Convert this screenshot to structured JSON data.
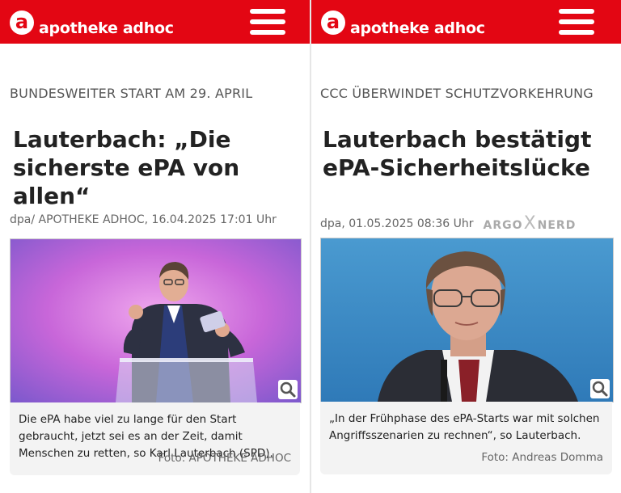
{
  "brand": {
    "logo_letter": "a",
    "name": "apotheke adhoc",
    "color": "#e30613"
  },
  "articles": [
    {
      "kicker": "BUNDESWEITER START AM 29. APRIL",
      "headline": "Lauterbach: „Die sicherste ePA von allen“",
      "meta": "dpa/ APOTHEKE ADHOC, 16.04.2025 17:01 Uhr",
      "caption": "Die ePA habe viel zu lange für den Start gebraucht, jetzt sei es an der Zeit, damit Menschen zu retten, so Karl Lauterbach (SPD).",
      "credit": "Foto: APOTHEKE ADHOC"
    },
    {
      "kicker": "CCC ÜBERWINDET SCHUTZVORKEHRUNG",
      "headline": "Lauterbach bestätigt ePA-Sicherheitslücke",
      "meta": "dpa, 01.05.2025 08:36 Uhr",
      "partner_left": "ARGO",
      "partner_x": "X",
      "partner_right": "NERD",
      "caption": "„In der Frühphase des ePA-Starts war mit solchen Angriffsszenarien zu rechnen“, so Lauterbach.",
      "credit": "Foto: Andreas Domma"
    }
  ]
}
